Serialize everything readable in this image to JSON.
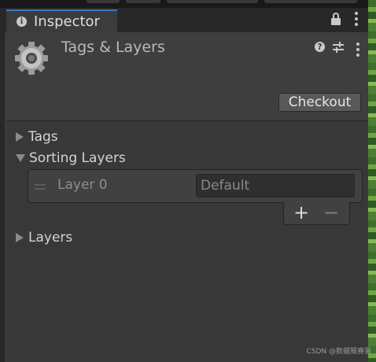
{
  "window": {
    "tab_title": "Inspector"
  },
  "component": {
    "title": "Tags & Layers",
    "checkout_label": "Checkout"
  },
  "tree": {
    "tags_label": "Tags",
    "sorting_layers_label": "Sorting Layers",
    "layers_label": "Layers"
  },
  "sorting_layers": [
    {
      "name": "Layer 0",
      "value": "Default"
    }
  ],
  "list_controls": {
    "add_label": "+",
    "remove_label": "−"
  },
  "watermark": "CSDN @数据猴赛雷",
  "icons": [
    "info-icon",
    "lock-icon",
    "more-icon",
    "gear-icon",
    "help-icon",
    "presets-icon",
    "expand-icon",
    "drag-handle-icon"
  ],
  "colors": {
    "tab_accent": "#3a79bb",
    "panel_bg": "#383838",
    "header_bg": "#3e3e3e"
  }
}
